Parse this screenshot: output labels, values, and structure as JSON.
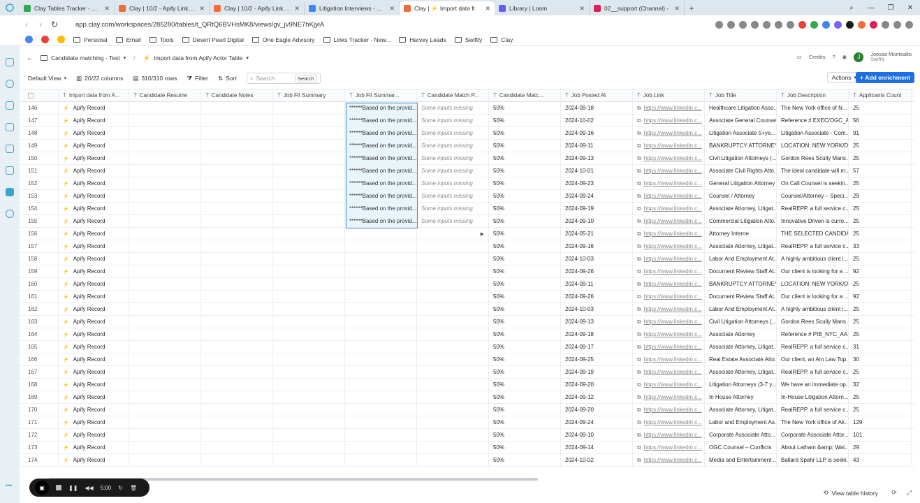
{
  "browser": {
    "tabs": [
      {
        "label": "Clay Tables Tracker - Goog",
        "color": "#34a853",
        "active": false
      },
      {
        "label": "Clay | 10/2 - Apify Linkedin",
        "color": "#f26b3a",
        "active": false
      },
      {
        "label": "Clay | 10/2 - Apify Linkedin",
        "color": "#f26b3a",
        "active": false
      },
      {
        "label": "Litigation Interviews - Goo",
        "color": "#4285f4",
        "active": false
      },
      {
        "label": "Clay | ⚡ Import data fr",
        "color": "#f26b3a",
        "active": true
      },
      {
        "label": "Library | Loom",
        "color": "#625df5",
        "active": false
      },
      {
        "label": "02__support (Channel) -",
        "color": "#e01e5a",
        "active": false
      }
    ],
    "url": "app.clay.com/workspaces/285280/tables/t_QRtQ6BVHsMK8/views/gv_jv9NE7hKjyiA",
    "bookmarks": [
      "Personal",
      "Email",
      "Tools",
      "Desert Pearl Digital",
      "One Eagle Advisory",
      "Links Tracker - New...",
      "Harvey Leads",
      "Swiftly",
      "Clay"
    ]
  },
  "header": {
    "crumb_parent": "Candidate matching - Test",
    "crumb_current": "Import data from Apify Actor Table",
    "credits": "Credits",
    "user_name": "Joessa Montealto",
    "user_org": "Swiftly",
    "avatar_initial": "J"
  },
  "toolbar": {
    "view": "Default View",
    "columns": "20/22 columns",
    "rows": "310/310 rows",
    "filter": "Filter",
    "sort": "Sort",
    "search_placeholder": "Search",
    "search_button": "Search",
    "actions": "Actions",
    "add_enrichment": "Add enrichment"
  },
  "columns": [
    "Import data from A...",
    "Candidate Resume",
    "Candidate Notes",
    "Job Fit Summary",
    "Job Fit Summar...",
    "Candidate Match P...",
    "Candidate Matc...",
    "Job Posted At",
    "Job Link",
    "Job Title",
    "Job Description",
    "Applicants Count"
  ],
  "rows": [
    {
      "n": "146",
      "imp": "Apify Record",
      "fsum": "******Based on the provid...",
      "mp": "Some inputs missing",
      "mat": "50%",
      "date": "2024-09-18",
      "link": "https://www.linkedin.c...",
      "title": "Healthcare Litigation Asso...",
      "desc": "The New York office of N...",
      "app": "25"
    },
    {
      "n": "147",
      "imp": "Apify Record",
      "fsum": "******Based on the provid...",
      "mp": "Some inputs missing",
      "mat": "50%",
      "date": "2024-10-02",
      "link": "https://www.linkedin.c...",
      "title": "Associate General Counsel",
      "desc": "Reference # EXEC/OGC_A...",
      "app": "56"
    },
    {
      "n": "148",
      "imp": "Apify Record",
      "fsum": "******Based on the provid...",
      "mp": "Some inputs missing",
      "mat": "50%",
      "date": "2024-09-16",
      "link": "https://www.linkedin.c...",
      "title": "Litigation Associate 5+ye...",
      "desc": "Litigation Associate - Com...",
      "app": "91"
    },
    {
      "n": "149",
      "imp": "Apify Record",
      "fsum": "******Based on the provid...",
      "mp": "Some inputs missing",
      "mat": "50%",
      "date": "2024-09-11",
      "link": "https://www.linkedin.c...",
      "title": "BANKRUPTCY ATTORNEY",
      "desc": "LOCATION: NEW YORK/D...",
      "app": "25"
    },
    {
      "n": "150",
      "imp": "Apify Record",
      "fsum": "******Based on the provid...",
      "mp": "Some inputs missing",
      "mat": "50%",
      "date": "2024-09-13",
      "link": "https://www.linkedin.c...",
      "title": "Civil Litigation Attorneys (...",
      "desc": "Gordon Rees Scully Mans...",
      "app": "25"
    },
    {
      "n": "151",
      "imp": "Apify Record",
      "fsum": "******Based on the provid...",
      "mp": "Some inputs missing",
      "mat": "50%",
      "date": "2024-10-01",
      "link": "https://www.linkedin.c...",
      "title": "Associate Civil Rights Atto...",
      "desc": "The ideal candidate will m...",
      "app": "57"
    },
    {
      "n": "152",
      "imp": "Apify Record",
      "fsum": "******Based on the provid...",
      "mp": "Some inputs missing",
      "mat": "50%",
      "date": "2024-09-23",
      "link": "https://www.linkedin.c...",
      "title": "General Litigation Attorney",
      "desc": "On Call Counsel is seekin...",
      "app": "25"
    },
    {
      "n": "153",
      "imp": "Apify Record",
      "fsum": "******Based on the provid...",
      "mp": "Some inputs missing",
      "mat": "50%",
      "date": "2024-09-24",
      "link": "https://www.linkedin.c...",
      "title": "Counsel / Attorney",
      "desc": "Counsel/Attorney – Speci...",
      "app": "29"
    },
    {
      "n": "154",
      "imp": "Apify Record",
      "fsum": "******Based on the provid...",
      "mp": "Some inputs missing",
      "mat": "50%",
      "date": "2024-09-19",
      "link": "https://www.linkedin.c...",
      "title": "Associate Attorney, Litigat...",
      "desc": "RealREPP, a full service c...",
      "app": "25"
    },
    {
      "n": "155",
      "imp": "Apify Record",
      "fsum": "******Based on the provid...",
      "mp": "Some inputs missing",
      "mat": "50%",
      "date": "2024-09-10",
      "link": "https://www.linkedin.c...",
      "title": "Commercial Litigation Atto...",
      "desc": "Innovative Driven is curre...",
      "app": "25"
    },
    {
      "n": "156",
      "imp": "Apify Record",
      "fsum": "",
      "mp": "",
      "mat": "50%",
      "date": "2024-05-21",
      "link": "https://www.linkedin.c...",
      "title": "Attorney Interne",
      "desc": "THE SELECTED CANDIDA...",
      "app": "25"
    },
    {
      "n": "157",
      "imp": "Apify Record",
      "fsum": "",
      "mp": "",
      "mat": "50%",
      "date": "2024-09-16",
      "link": "https://www.linkedin.c...",
      "title": "Associate Attorney, Litigat...",
      "desc": "RealREPP, a full service c...",
      "app": "33"
    },
    {
      "n": "158",
      "imp": "Apify Record",
      "fsum": "",
      "mp": "",
      "mat": "50%",
      "date": "2024-10-03",
      "link": "https://www.linkedin.c...",
      "title": "Labor And Employment At...",
      "desc": "A highly ambitious client i...",
      "app": "25"
    },
    {
      "n": "159",
      "imp": "Apify Record",
      "fsum": "",
      "mp": "",
      "mat": "50%",
      "date": "2024-09-26",
      "link": "https://www.linkedin.c...",
      "title": "Document Review Staff At...",
      "desc": "Our client is looking for a ...",
      "app": "92"
    },
    {
      "n": "160",
      "imp": "Apify Record",
      "fsum": "",
      "mp": "",
      "mat": "50%",
      "date": "2024-09-11",
      "link": "https://www.linkedin.c...",
      "title": "BANKRUPTCY ATTORNEY",
      "desc": "LOCATION: NEW YORK/D...",
      "app": "25"
    },
    {
      "n": "161",
      "imp": "Apify Record",
      "fsum": "",
      "mp": "",
      "mat": "50%",
      "date": "2024-09-26",
      "link": "https://www.linkedin.c...",
      "title": "Document Review Staff At...",
      "desc": "Our client is looking for a ...",
      "app": "92"
    },
    {
      "n": "162",
      "imp": "Apify Record",
      "fsum": "",
      "mp": "",
      "mat": "50%",
      "date": "2024-10-03",
      "link": "https://www.linkedin.c...",
      "title": "Labor And Employment At...",
      "desc": "A highly ambitious client i...",
      "app": "25"
    },
    {
      "n": "163",
      "imp": "Apify Record",
      "fsum": "",
      "mp": "",
      "mat": "50%",
      "date": "2024-09-13",
      "link": "https://www.linkedin.c...",
      "title": "Civil Litigation Attorneys (...",
      "desc": "Gordon Rees Scully Mans...",
      "app": "25"
    },
    {
      "n": "164",
      "imp": "Apify Record",
      "fsum": "",
      "mp": "",
      "mat": "50%",
      "date": "2024-09-18",
      "link": "https://www.linkedin.c...",
      "title": "Associate Attorney",
      "desc": "Reference # PIB_NYC_AA...",
      "app": "25"
    },
    {
      "n": "165",
      "imp": "Apify Record",
      "fsum": "",
      "mp": "",
      "mat": "50%",
      "date": "2024-09-17",
      "link": "https://www.linkedin.c...",
      "title": "Associate Attorney, Litigat...",
      "desc": "RealREPP, a full service c...",
      "app": "31"
    },
    {
      "n": "166",
      "imp": "Apify Record",
      "fsum": "",
      "mp": "",
      "mat": "50%",
      "date": "2024-09-25",
      "link": "https://www.linkedin.c...",
      "title": "Real Estate Associate Atto...",
      "desc": "Our client, an Am Law Top...",
      "app": "30"
    },
    {
      "n": "167",
      "imp": "Apify Record",
      "fsum": "",
      "mp": "",
      "mat": "50%",
      "date": "2024-09-19",
      "link": "https://www.linkedin.c...",
      "title": "Associate Attorney, Litigat...",
      "desc": "RealREPP, a full service c...",
      "app": "25"
    },
    {
      "n": "168",
      "imp": "Apify Record",
      "fsum": "",
      "mp": "",
      "mat": "50%",
      "date": "2024-09-20",
      "link": "https://www.linkedin.c...",
      "title": "Litigation Attorneys (3-7 y...",
      "desc": "We have an immediate op...",
      "app": "32"
    },
    {
      "n": "169",
      "imp": "Apify Record",
      "fsum": "",
      "mp": "",
      "mat": "50%",
      "date": "2024-09-12",
      "link": "https://www.linkedin.c...",
      "title": "In House Attorney",
      "desc": "In-House Litigation Attorn...",
      "app": "25"
    },
    {
      "n": "170",
      "imp": "Apify Record",
      "fsum": "",
      "mp": "",
      "mat": "50%",
      "date": "2024-09-20",
      "link": "https://www.linkedin.c...",
      "title": "Associate Attorney, Litigat...",
      "desc": "RealREPP, a full service c...",
      "app": "25"
    },
    {
      "n": "171",
      "imp": "Apify Record",
      "fsum": "",
      "mp": "",
      "mat": "50%",
      "date": "2024-09-24",
      "link": "https://www.linkedin.c...",
      "title": "Labor and Employment As...",
      "desc": "The New York office of Ak...",
      "app": "129"
    },
    {
      "n": "172",
      "imp": "Apify Record",
      "fsum": "",
      "mp": "",
      "mat": "50%",
      "date": "2024-09-10",
      "link": "https://www.linkedin.c...",
      "title": "Corporate Associate Atto...",
      "desc": "Corporate Associate Attor...",
      "app": "101"
    },
    {
      "n": "173",
      "imp": "Apify Record",
      "fsum": "",
      "mp": "",
      "mat": "50%",
      "date": "2024-09-14",
      "link": "https://www.linkedin.c...",
      "title": "OGC Counsel – Conflicts",
      "desc": "About Latham &amp; Wat...",
      "app": "29"
    },
    {
      "n": "174",
      "imp": "Apify Record",
      "fsum": "",
      "mp": "",
      "mat": "50%",
      "date": "2024-10-02",
      "link": "https://www.linkedin.c...",
      "title": "Media and Entertainment ...",
      "desc": "Ballard Spahr LLP is seeki...",
      "app": "43"
    }
  ],
  "recorder": {
    "time": "5:00"
  },
  "footer": {
    "history": "View table history"
  }
}
